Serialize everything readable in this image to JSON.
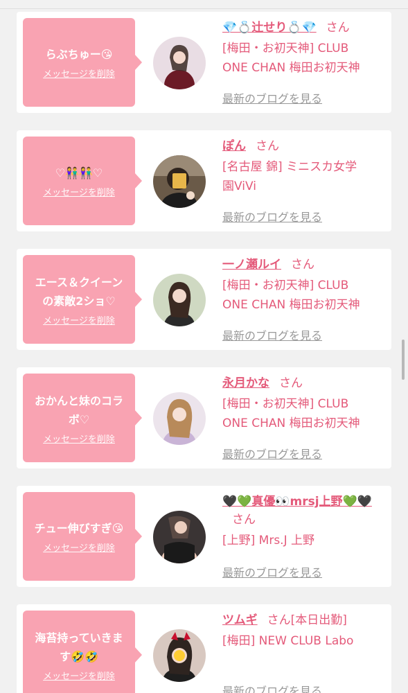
{
  "delete_label": "メッセージを削除",
  "san_label": "さん",
  "blog_label": "最新のブログを見る",
  "messages": [
    {
      "message_lines": [
        "らぶちゅー😘"
      ],
      "girl_name": "💎💍辻せり💍💎",
      "name_suffix": "",
      "shop_lines": [
        "[梅田・お初天神] CLUB",
        "ONE CHAN 梅田お初天神"
      ],
      "avatar_icon": "portrait-photo"
    },
    {
      "message_lines": [
        "♡👫👫♡"
      ],
      "girl_name": "ぽん",
      "name_suffix": "",
      "shop_lines": [
        "[名古屋 錦] ミニスカ女学",
        "園ViVi"
      ],
      "avatar_icon": "portrait-photo"
    },
    {
      "message_lines": [
        "エース＆クイーン",
        "の素敵2ショ♡"
      ],
      "girl_name": "一ノ瀬ルイ",
      "name_suffix": "",
      "shop_lines": [
        "[梅田・お初天神] CLUB",
        "ONE CHAN 梅田お初天神"
      ],
      "avatar_icon": "portrait-photo"
    },
    {
      "message_lines": [
        "おかんと妹のコラ",
        "ボ♡"
      ],
      "girl_name": "永月かな",
      "name_suffix": "",
      "shop_lines": [
        "[梅田・お初天神] CLUB",
        "ONE CHAN 梅田お初天神"
      ],
      "avatar_icon": "portrait-photo"
    },
    {
      "message_lines": [
        "チュー伸びすぎ😘"
      ],
      "girl_name": "🖤💚真優👀mrsj上野💚🖤",
      "name_suffix": "",
      "shop_lines": [
        "[上野] Mrs.J 上野"
      ],
      "avatar_icon": "portrait-photo"
    },
    {
      "message_lines": [
        "海苔持っていきま",
        "す🤣🤣"
      ],
      "girl_name": "ツムギ",
      "name_suffix": "[本日出勤]",
      "shop_lines": [
        "[梅田] NEW CLUB Labo"
      ],
      "avatar_icon": "portrait-photo"
    }
  ],
  "colors": {
    "bubble_bg": "#f9a3b2",
    "accent_text": "#e45a7a",
    "link_gray": "#999999",
    "page_bg": "#f1f1f1"
  }
}
